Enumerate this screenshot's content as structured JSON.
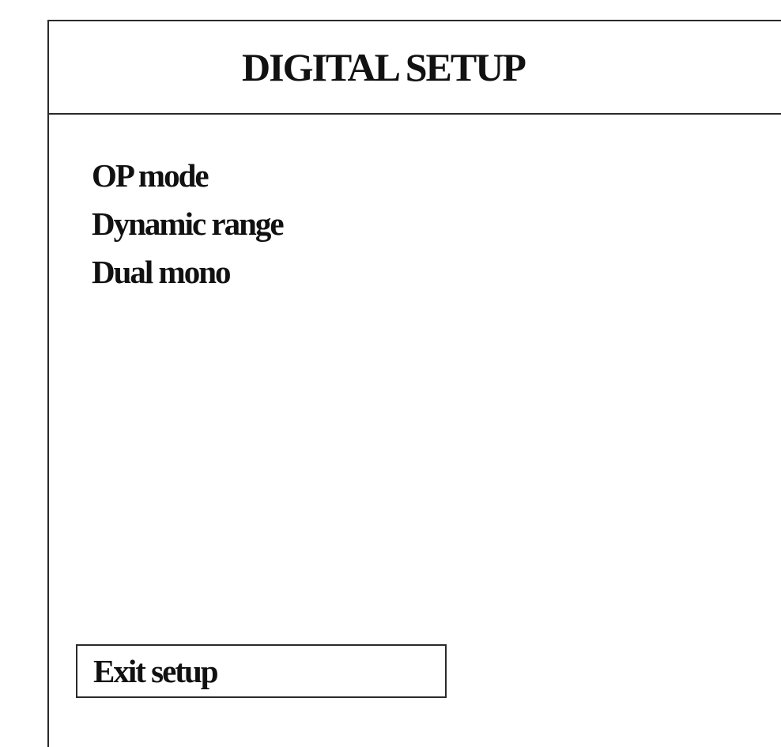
{
  "menu": {
    "title": "DIGITAL SETUP",
    "options": [
      {
        "label": "OP mode"
      },
      {
        "label": "Dynamic range"
      },
      {
        "label": "Dual mono"
      }
    ],
    "exit_label": "Exit setup"
  }
}
